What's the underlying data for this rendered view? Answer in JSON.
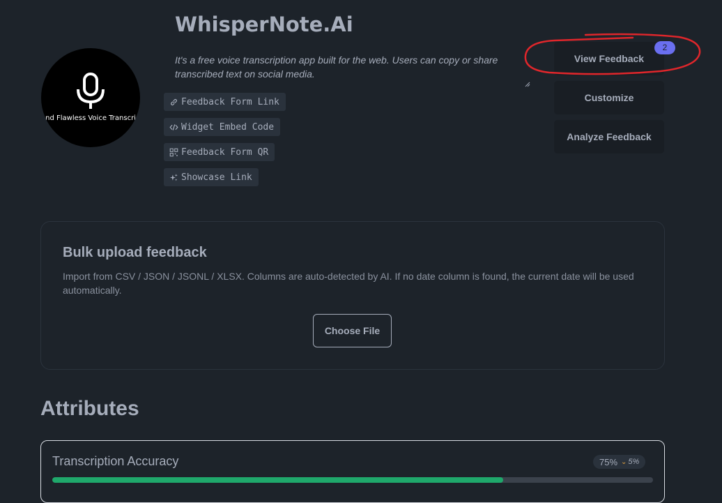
{
  "app": {
    "logo_text": "and Flawless Voice Transcrip",
    "title": "WhisperNote.Ai",
    "description": "It's a free voice transcription app built for the web. Users can copy or share transcribed text on social media."
  },
  "links": [
    {
      "label": "Feedback Form Link",
      "icon": "link-icon"
    },
    {
      "label": "Widget Embed Code",
      "icon": "code-icon"
    },
    {
      "label": "Feedback Form QR",
      "icon": "qr-code-icon"
    },
    {
      "label": "Showcase Link",
      "icon": "sparkles-icon"
    }
  ],
  "actions": {
    "view_feedback": "View Feedback",
    "view_feedback_badge": "2",
    "customize": "Customize",
    "analyze_feedback": "Analyze Feedback"
  },
  "bulk_upload": {
    "title": "Bulk upload feedback",
    "description": "Import from CSV / JSON / JSONL / XLSX. Columns are auto-detected by AI. If no date column is found, the current date will be used automatically.",
    "button": "Choose File"
  },
  "attributes": {
    "heading": "Attributes",
    "items": [
      {
        "name": "Transcription Accuracy",
        "score": "75%",
        "delta": "5%",
        "delta_direction": "down",
        "progress": 0.75
      }
    ]
  },
  "colors": {
    "background": "#1d232a",
    "badge": "#6a6ff0",
    "progress_fill": "#1fa86b",
    "annotation": "#e0262b"
  }
}
